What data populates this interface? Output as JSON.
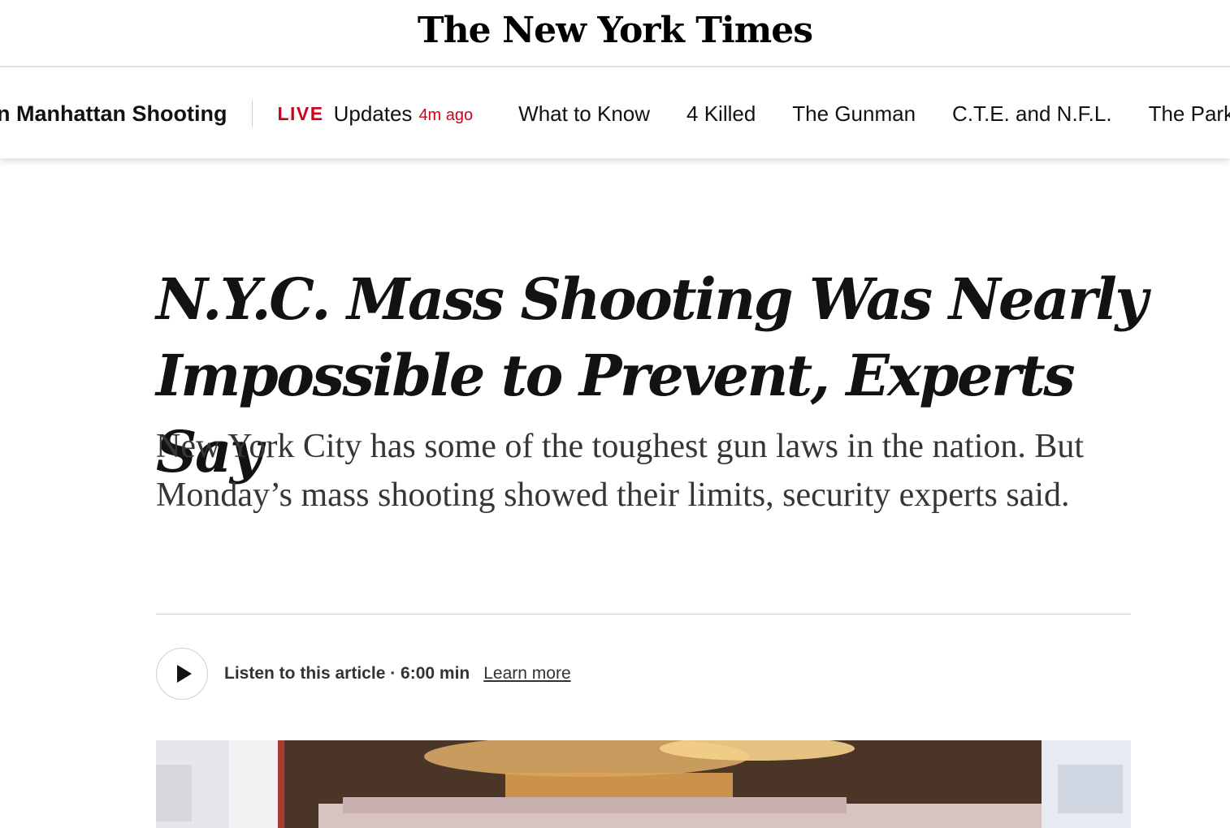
{
  "masthead": {
    "logo": "The New York Times"
  },
  "story_bar": {
    "title": "n Manhattan Shooting",
    "live_label": "LIVE",
    "updates_label": "Updates",
    "time_ago": "4m ago",
    "links": [
      "What to Know",
      "4 Killed",
      "The Gunman",
      "C.T.E. and N.F.L.",
      "The Park"
    ]
  },
  "article": {
    "headline": "N.Y.C. Mass Shooting Was Nearly Impossible to Prevent, Experts Say",
    "summary": "New York City has some of the toughest gun laws in the nation. But Monday’s mass shooting showed their limits, security experts said.",
    "listen": {
      "text": "Listen to this article · 6:00 min",
      "learn_more": "Learn more"
    }
  },
  "colors": {
    "live_red": "#d0021b",
    "text": "#121212",
    "summary_text": "#363636"
  }
}
